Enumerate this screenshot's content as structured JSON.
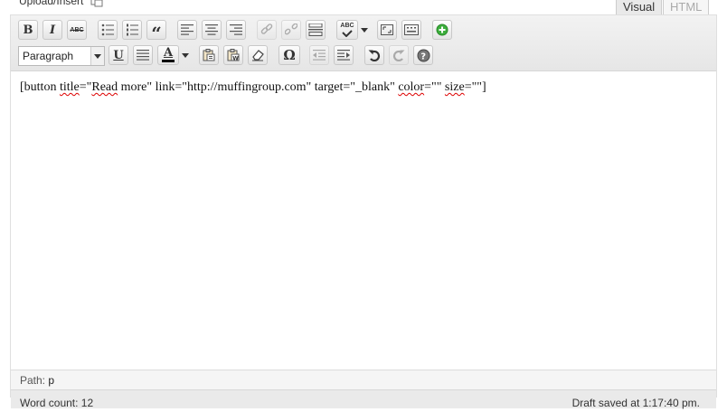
{
  "header": {
    "upload_label": "Upload/Insert",
    "tabs": [
      {
        "label": "Visual",
        "active": true
      },
      {
        "label": "HTML",
        "active": false
      }
    ]
  },
  "toolbar": {
    "row1": [
      {
        "name": "bold-button",
        "glyph": "B"
      },
      {
        "name": "italic-button",
        "glyph": "I"
      },
      {
        "name": "strikethrough-button",
        "glyph": "ABC"
      },
      {
        "name": "bullet-list-button",
        "icon": "bullet-list-icon"
      },
      {
        "name": "numbered-list-button",
        "icon": "numbered-list-icon"
      },
      {
        "name": "blockquote-button",
        "glyph": "“"
      },
      {
        "name": "align-left-button",
        "icon": "align-left-icon"
      },
      {
        "name": "align-center-button",
        "icon": "align-center-icon"
      },
      {
        "name": "align-right-button",
        "icon": "align-right-icon"
      },
      {
        "name": "insert-link-button",
        "icon": "link-icon",
        "disabled": true
      },
      {
        "name": "unlink-button",
        "icon": "unlink-icon",
        "disabled": true
      },
      {
        "name": "insert-more-button",
        "icon": "more-tag-icon"
      },
      {
        "name": "spellcheck-button",
        "glyph": "ABC"
      },
      {
        "name": "fullscreen-button",
        "icon": "fullscreen-icon"
      },
      {
        "name": "kitchen-sink-button",
        "icon": "kitchen-sink-icon"
      },
      {
        "name": "shortcode-button",
        "icon": "plus-circle-icon"
      }
    ],
    "format_select_value": "Paragraph",
    "row2": [
      {
        "name": "underline-button",
        "glyph": "U"
      },
      {
        "name": "justify-button",
        "icon": "justify-icon"
      },
      {
        "name": "text-color-button",
        "glyph": "A"
      },
      {
        "name": "paste-text-button",
        "icon": "paste-text-icon"
      },
      {
        "name": "paste-word-button",
        "icon": "paste-word-icon"
      },
      {
        "name": "clear-format-button",
        "icon": "eraser-icon"
      },
      {
        "name": "special-char-button",
        "glyph": "Ω"
      },
      {
        "name": "outdent-button",
        "icon": "outdent-icon",
        "disabled": true
      },
      {
        "name": "indent-button",
        "icon": "indent-icon"
      },
      {
        "name": "undo-button",
        "icon": "undo-icon"
      },
      {
        "name": "redo-button",
        "icon": "redo-icon",
        "disabled": true
      },
      {
        "name": "help-button",
        "icon": "help-icon"
      }
    ]
  },
  "content": {
    "t1": "[button ",
    "t2": "title",
    "t3": "=\"",
    "t4": "Read",
    "t5": " more\" link=\"http://muffingroup.com\" target=\"_blank\" ",
    "t6": "color",
    "t7": "=\"\" ",
    "t8": "size",
    "t9": "=\"\"]"
  },
  "path_bar": {
    "label": "Path:",
    "value": "p"
  },
  "status": {
    "word_count": "Word count: 12",
    "draft_saved": "Draft saved at 1:17:40 pm."
  }
}
